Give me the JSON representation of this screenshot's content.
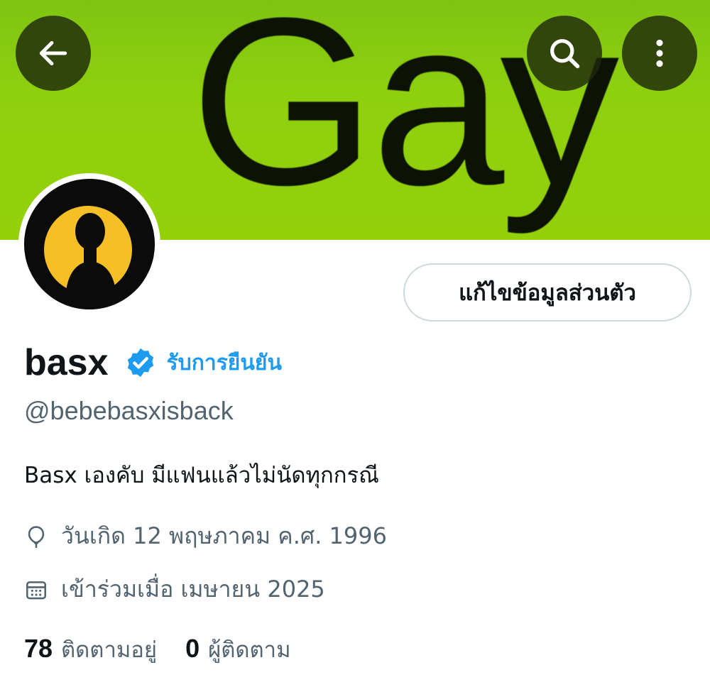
{
  "banner": {
    "text": "Gay",
    "color": "#8fd00e"
  },
  "nav": {
    "back_icon": "arrow-left-icon",
    "search_icon": "search-icon",
    "more_icon": "more-vertical-icon"
  },
  "avatar": {
    "description_icon": "avatar-silhouette-icon",
    "background": "#0b0b0b",
    "accent": "#f6bf26"
  },
  "profile": {
    "edit_button_label": "แก้ไขข้อมูลส่วนตัว",
    "display_name": "basx",
    "verified_label": "รับการยืนยัน",
    "verified_color": "#1d9bf0",
    "handle": "@bebebasxisback",
    "bio": "Basx เองคับ มีแฟนแล้วไม่นัดทุกกรณี",
    "birthday": "วันเกิด 12 พฤษภาคม ค.ศ. 1996",
    "joined": "เข้าร่วมเมื่อ เมษายน 2025"
  },
  "stats": {
    "following_count": "78",
    "following_label": "ติดตามอยู่",
    "followers_count": "0",
    "followers_label": "ผู้ติดตาม"
  }
}
